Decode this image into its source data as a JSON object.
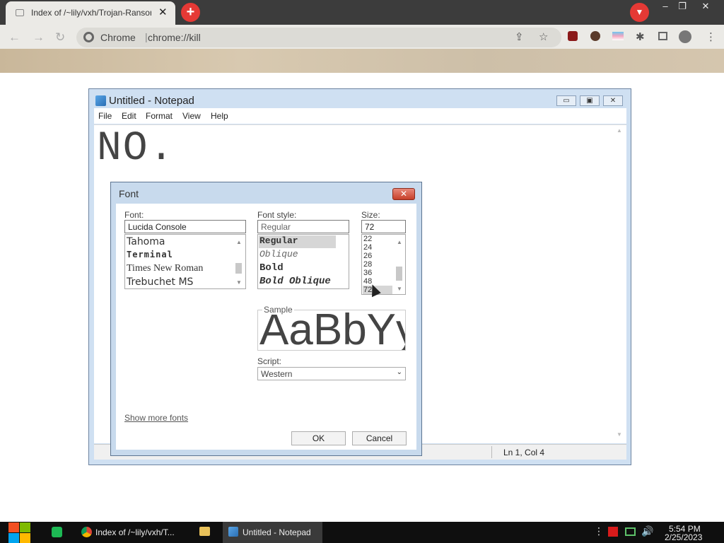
{
  "browser": {
    "tab_title": "Index of /~lily/vxh/Trojan-Ransom",
    "tab_close_glyph": "✕",
    "new_tab_glyph": "+",
    "site_chip": "Chrome",
    "address": "chrome://kill",
    "window_controls": [
      "–",
      "❐",
      "✕"
    ],
    "accent_color": "#e53935"
  },
  "notepad": {
    "title": "Untitled - Notepad",
    "menu": [
      "File",
      "Edit",
      "Format",
      "View",
      "Help"
    ],
    "content": "NO.",
    "status_position": "Ln 1, Col 4"
  },
  "font_dialog": {
    "title": "Font",
    "font_label": "Font:",
    "font_value": "Lucida Console",
    "font_list": [
      "Tahoma",
      "Terminal",
      "Times New Roman",
      "Trebuchet MS"
    ],
    "style_label": "Font style:",
    "style_value": "Regular",
    "style_list": [
      "Regular",
      "Oblique",
      "Bold",
      "Bold Oblique"
    ],
    "size_label": "Size:",
    "size_value": "72",
    "size_list": [
      "22",
      "24",
      "26",
      "28",
      "36",
      "48",
      "72"
    ],
    "sample_label": "Sample",
    "sample_text": "AaBbYyZz",
    "script_label": "Script:",
    "script_value": "Western",
    "more_fonts": "Show more fonts",
    "ok": "OK",
    "cancel": "Cancel"
  },
  "taskbar": {
    "apps": [
      "Index of /~lily/vxh/T...",
      "Untitled - Notepad"
    ],
    "time": "5:54 PM",
    "date": "2/25/2023"
  }
}
